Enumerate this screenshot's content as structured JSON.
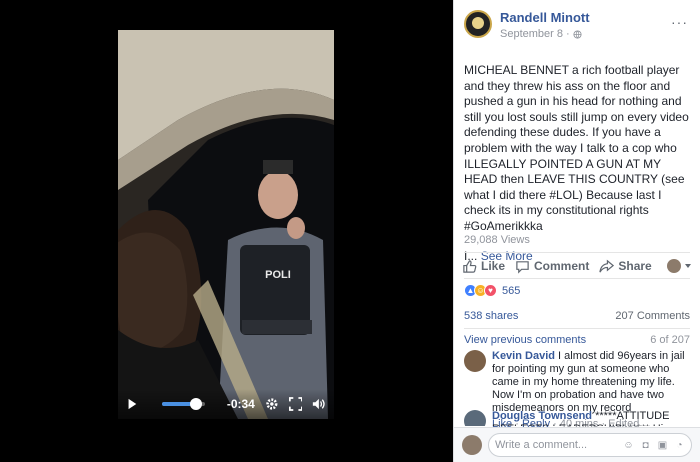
{
  "video": {
    "time_remaining": "-0:34",
    "progress_fraction": 0.78,
    "play_icon": "play-icon",
    "settings_icon": "gear-icon",
    "fullscreen_icon": "expand-icon",
    "volume_icon": "volume-icon",
    "badge_text": "POLI"
  },
  "post": {
    "author": "Randell Minott",
    "date": "September 8 · ",
    "privacy_icon": "globe-icon",
    "more_label": "···",
    "text": "MICHEAL BENNET a rich football player and they threw his ass on the floor and pushed a gun in his head for nothing and still you lost souls still jump on every video defending these dudes. If you have a problem with the way I talk to a cop who ILLEGALLY POINTED A GUN AT MY HEAD then LEAVE THIS COUNTRY (see what I did there #LOL) Because last I check its in my constitutional rights #GoAmerikkka",
    "ellipsis": "I...",
    "see_more": "See More",
    "views": "29,088 Views"
  },
  "actions": {
    "like": "Like",
    "comment": "Comment",
    "share": "Share"
  },
  "reactions": {
    "count": "565",
    "types": [
      "like",
      "haha",
      "love"
    ],
    "colors": {
      "like": "#4080ff",
      "haha": "#f7b125",
      "love": "#f25268"
    }
  },
  "stats": {
    "shares": "538 shares",
    "comments": "207 Comments"
  },
  "comments_header": {
    "view_previous": "View previous comments",
    "position": "6 of 207"
  },
  "comments": [
    {
      "name": "Kevin David",
      "text": " I almost did 96years in jail for pointing my gun at someone who came in my home threatening my life. Now I'm on probation and have two misdemeanors on my record",
      "like": "Like",
      "reply": "Reply",
      "time": " · 40 mins · Edited"
    },
    {
      "name": "Douglas Townsend",
      "text": " *****ATTITUDE REFLECTS LEADERSHIP! ***** His supervisors are very"
    }
  ],
  "composer": {
    "placeholder": "Write a comment..."
  },
  "colors": {
    "link": "#365899",
    "accent": "#4a90e2"
  }
}
